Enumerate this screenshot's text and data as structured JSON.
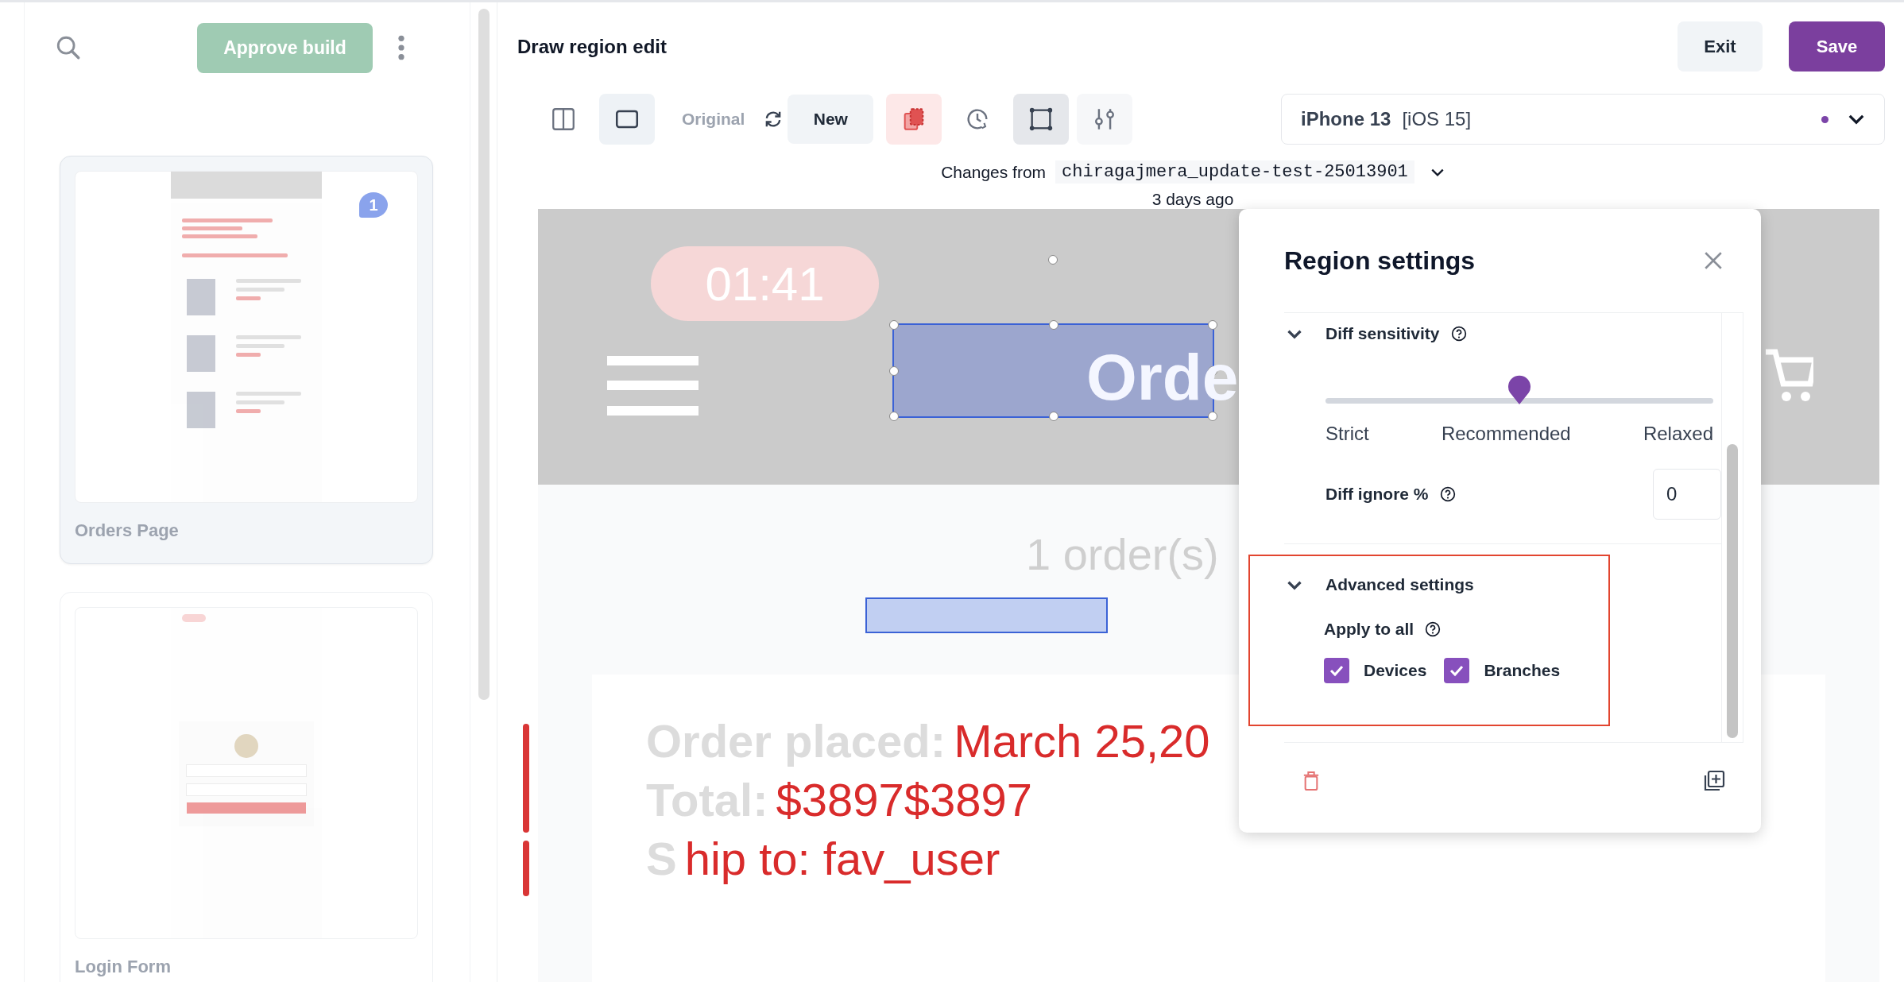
{
  "sidebar": {
    "approve_button": "Approve build",
    "pages": [
      {
        "name": "Orders Page",
        "selected": true,
        "comments": "1"
      },
      {
        "name": "Login Form",
        "selected": false
      }
    ]
  },
  "header": {
    "title": "Draw region edit",
    "exit_button": "Exit",
    "save_button": "Save"
  },
  "toolbar": {
    "views": [
      {
        "kind": "split",
        "selected": false
      },
      {
        "kind": "single",
        "selected": true
      }
    ],
    "original_label": "Original",
    "new_button": "New",
    "tools": [
      {
        "kind": "diff",
        "selected": true
      },
      {
        "kind": "history",
        "selected": false
      },
      {
        "kind": "region",
        "selected": true
      },
      {
        "kind": "adjust",
        "selected": false
      }
    ],
    "device": {
      "name": "iPhone 13",
      "os": "[iOS 15]"
    }
  },
  "changes": {
    "label": "Changes from",
    "branch": "chiragajmera_update-test-25013901",
    "time": "3 days ago"
  },
  "preview": {
    "timer": "01:41",
    "title": "Orde",
    "orders_count": "1 order(s)",
    "lines": [
      {
        "label": "Order placed:",
        "diff": "March 25,20"
      },
      {
        "label": "Total:",
        "diff": "$3897$3897"
      },
      {
        "label": "S",
        "diff": "hip to: fav_user"
      }
    ]
  },
  "region_settings": {
    "title": "Region settings",
    "diff_sensitivity": {
      "label": "Diff sensitivity",
      "expanded": true,
      "level": 0.5,
      "ticks": [
        "Strict",
        "Recommended",
        "Relaxed"
      ]
    },
    "diff_ignore": {
      "label": "Diff ignore %",
      "value": "0"
    },
    "advanced": {
      "label": "Advanced settings",
      "expanded": true,
      "apply_label": "Apply to all",
      "options": [
        {
          "label": "Devices",
          "checked": true
        },
        {
          "label": "Branches",
          "checked": true
        }
      ]
    }
  }
}
